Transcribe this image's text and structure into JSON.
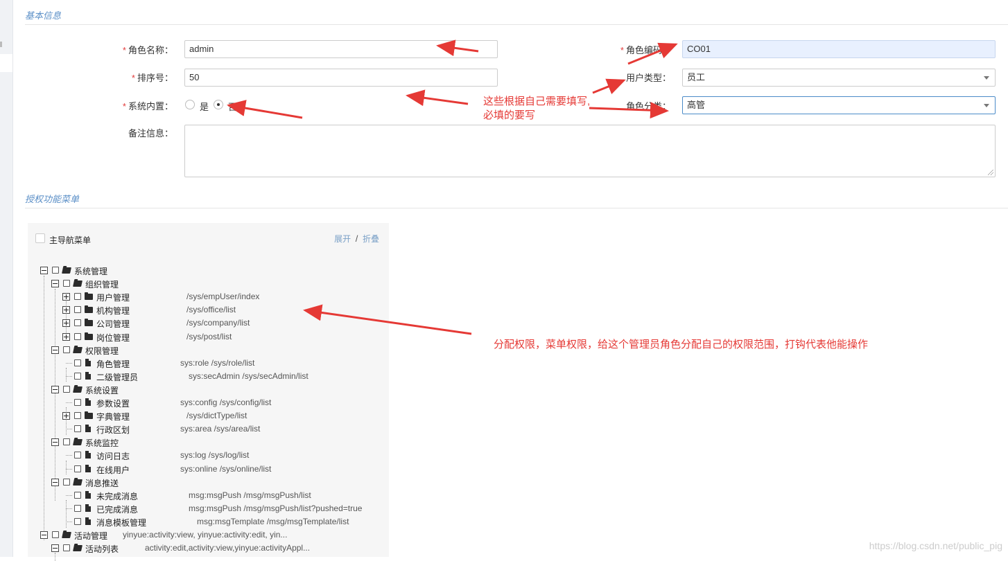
{
  "section_basic": "基本信息",
  "section_menu": "授权功能菜单",
  "form": {
    "role_name": {
      "label": "角色名称：",
      "value": "admin"
    },
    "role_code": {
      "label": "角色编码：",
      "value": "CO01"
    },
    "sort": {
      "label": "排序号：",
      "value": "50"
    },
    "user_type": {
      "label": "用户类型：",
      "value": "员工"
    },
    "builtin": {
      "label": "系统内置：",
      "yes": "是",
      "no": "否",
      "selected": "否"
    },
    "role_category": {
      "label": "角色分类：",
      "value": "高管"
    },
    "remarks": {
      "label": "备注信息：",
      "value": ""
    }
  },
  "tree": {
    "root_label": "主导航菜单",
    "expand": "展开",
    "sep": "/",
    "collapse": "折叠",
    "nodes": [
      {
        "name": "系统管理",
        "perm": ""
      },
      {
        "name": "组织管理",
        "perm": ""
      },
      {
        "name": "用户管理",
        "perm": "/sys/empUser/index"
      },
      {
        "name": "机构管理",
        "perm": "/sys/office/list"
      },
      {
        "name": "公司管理",
        "perm": "/sys/company/list"
      },
      {
        "name": "岗位管理",
        "perm": "/sys/post/list"
      },
      {
        "name": "权限管理",
        "perm": ""
      },
      {
        "name": "角色管理",
        "perm": "sys:role   /sys/role/list"
      },
      {
        "name": "二级管理员",
        "perm": "sys:secAdmin   /sys/secAdmin/list"
      },
      {
        "name": "系统设置",
        "perm": ""
      },
      {
        "name": "参数设置",
        "perm": "sys:config   /sys/config/list"
      },
      {
        "name": "字典管理",
        "perm": "/sys/dictType/list"
      },
      {
        "name": "行政区划",
        "perm": "sys:area   /sys/area/list"
      },
      {
        "name": "系统监控",
        "perm": ""
      },
      {
        "name": "访问日志",
        "perm": "sys:log   /sys/log/list"
      },
      {
        "name": "在线用户",
        "perm": "sys:online   /sys/online/list"
      },
      {
        "name": "消息推送",
        "perm": ""
      },
      {
        "name": "未完成消息",
        "perm": "msg:msgPush   /msg/msgPush/list"
      },
      {
        "name": "已完成消息",
        "perm": "msg:msgPush   /msg/msgPush/list?pushed=true"
      },
      {
        "name": "消息模板管理",
        "perm": "msg:msgTemplate   /msg/msgTemplate/list"
      },
      {
        "name": "活动管理",
        "perm": "yinyue:activity:view, yinyue:activity:edit, yin..."
      },
      {
        "name": "活动列表",
        "perm": "activity:edit,activity:view,yinyue:activityAppl..."
      }
    ]
  },
  "annotations": {
    "form_note_1": "这些根据自己需要填写,",
    "form_note_2": "必填的要写",
    "tree_note": "分配权限，菜单权限，给这个管理员角色分配自己的权限范围，打钩代表他能操作"
  },
  "watermark": "https://blog.csdn.net/public_pig",
  "colors": {
    "annotation": "#e53935",
    "section_title": "#5b8fc7",
    "readonly_bg": "#e8f0fe",
    "required": "#e23b3b"
  }
}
